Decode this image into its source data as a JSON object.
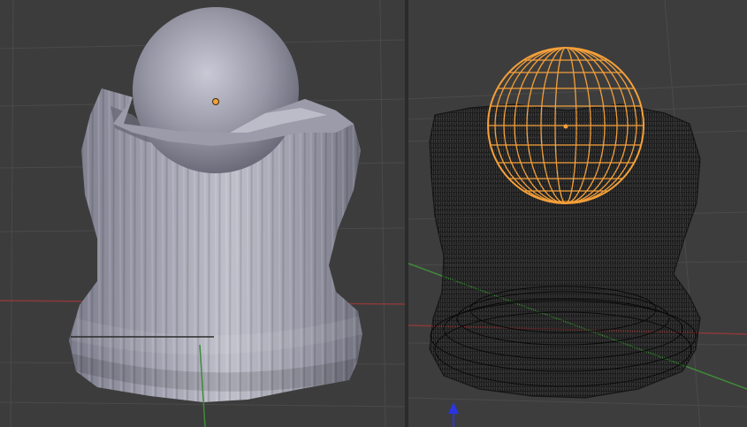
{
  "viewports": [
    {
      "id": "solid",
      "shading": "solid",
      "objects": [
        "cloth-mesh",
        "sphere"
      ],
      "selected": "sphere"
    },
    {
      "id": "wireframe",
      "shading": "wireframe",
      "objects": [
        "cloth-mesh",
        "sphere"
      ],
      "selected": "sphere"
    }
  ],
  "colors": {
    "background": "#3c3c3c",
    "grid": "#4a4a4a",
    "axis_x": "#8a3a3a",
    "axis_y": "#3f8a3a",
    "axis_z": "#2a35e0",
    "solid_mesh": "#9a9aa8",
    "selection": "#f5a03a",
    "wire": "#0a0a0a",
    "origin": "#f5a03a"
  },
  "icons": [
    "object-origin-icon",
    "z-axis-arrow-icon"
  ]
}
